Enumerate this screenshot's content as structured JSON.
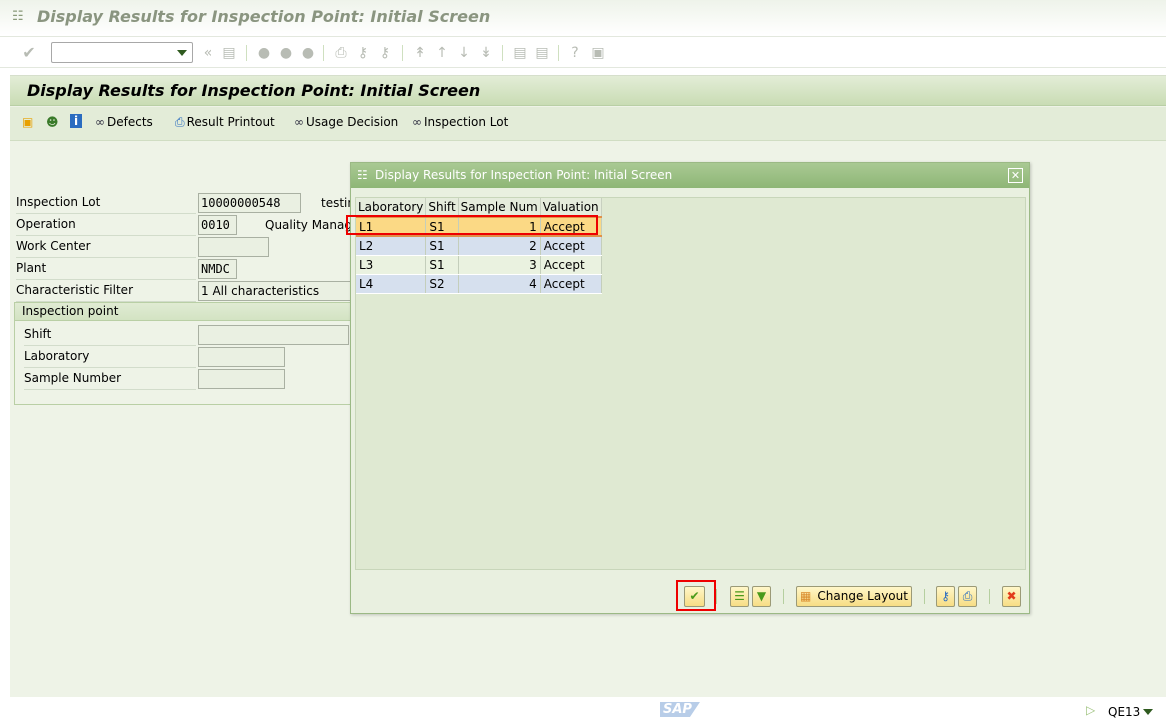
{
  "window": {
    "title": "Display Results for Inspection Point: Initial Screen"
  },
  "toolbar": {
    "command_field": "",
    "icons": [
      "enter-icon",
      "back-icon",
      "save-icon",
      "back-nav-icon",
      "exit-icon",
      "cancel-icon",
      "print-icon",
      "find-icon",
      "find-next-icon",
      "first-page-icon",
      "prev-page-icon",
      "next-page-icon",
      "last-page-icon",
      "new-session-icon",
      "shortcut-icon",
      "help-icon",
      "customize-icon"
    ]
  },
  "header": {
    "title": "Display Results for Inspection Point: Initial Screen"
  },
  "app_toolbar": {
    "defects": "Defects",
    "result_printout": "Result Printout",
    "usage_decision": "Usage Decision",
    "inspection_lot": "Inspection Lot"
  },
  "form": {
    "inspection_lot": {
      "label": "Inspection Lot",
      "value": "10000000548",
      "desc": "testin"
    },
    "operation": {
      "label": "Operation",
      "value": "0010",
      "desc": "Quality Manage"
    },
    "work_center": {
      "label": "Work Center",
      "value": ""
    },
    "plant": {
      "label": "Plant",
      "value": "NMDC"
    },
    "char_filter": {
      "label": "Characteristic Filter",
      "value": "1 All characteristics"
    },
    "group": {
      "title": "Inspection point",
      "shift": {
        "label": "Shift",
        "value": ""
      },
      "laboratory": {
        "label": "Laboratory",
        "value": ""
      },
      "sample_number": {
        "label": "Sample Number",
        "value": ""
      }
    }
  },
  "dialog": {
    "title": "Display Results for Inspection Point: Initial Screen",
    "columns": [
      "Laboratory",
      "Shift",
      "Sample Num",
      "Valuation"
    ],
    "rows": [
      [
        "L1",
        "S1",
        "1",
        "Accept"
      ],
      [
        "L2",
        "S1",
        "2",
        "Accept"
      ],
      [
        "L3",
        "S1",
        "3",
        "Accept"
      ],
      [
        "L4",
        "S2",
        "4",
        "Accept"
      ]
    ],
    "selected_row": 0,
    "change_layout": "Change Layout"
  },
  "status": {
    "transaction": "QE13",
    "logo": "SAP"
  }
}
